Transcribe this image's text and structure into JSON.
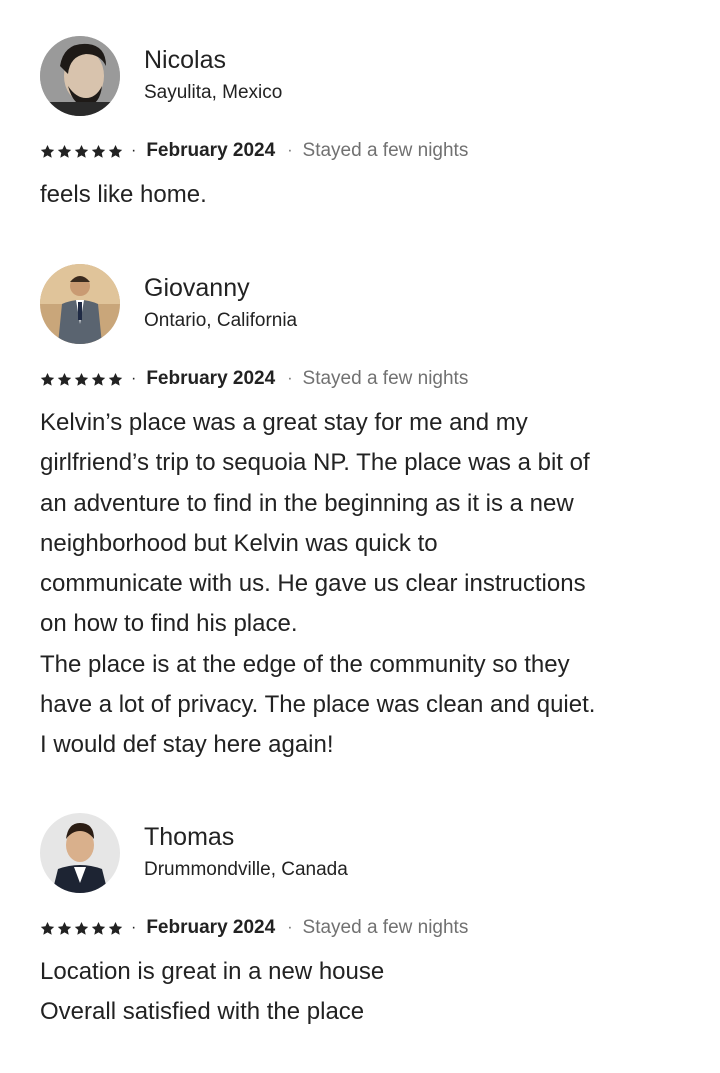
{
  "reviews": [
    {
      "name": "Nicolas",
      "location": "Sayulita, Mexico",
      "rating": 5,
      "date": "February 2024",
      "stay": "Stayed a few nights",
      "separator": "·",
      "body": [
        "feels like home."
      ],
      "avatar_icon": "avatar-photo-icon"
    },
    {
      "name": "Giovanny",
      "location": "Ontario, California",
      "rating": 5,
      "date": "February 2024",
      "stay": "Stayed a few nights",
      "separator": "·",
      "body": [
        "Kelvin’s place was a great stay for me and my",
        "girlfriend’s trip to sequoia NP. The place was a bit of",
        "an adventure to find in the beginning as it is a new",
        "neighborhood but Kelvin was quick to",
        "communicate with us. He gave us clear instructions",
        "on how to find his place.",
        "The place is at the edge of the community so they",
        "have a lot of privacy. The place was clean and quiet.",
        "I would def stay here again!"
      ],
      "avatar_icon": "avatar-photo-icon"
    },
    {
      "name": "Thomas",
      "location": "Drummondville, Canada",
      "rating": 5,
      "date": "February 2024",
      "stay": "Stayed a few nights",
      "separator": "·",
      "body": [
        "Location is great in a new house",
        "Overall satisfied with the place"
      ],
      "avatar_icon": "avatar-photo-icon"
    }
  ],
  "colors": {
    "text_primary": "#222222",
    "text_secondary": "#717171",
    "background": "#ffffff"
  }
}
